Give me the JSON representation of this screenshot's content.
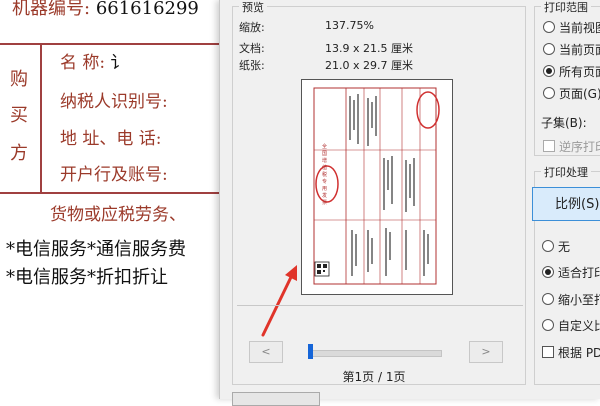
{
  "invoice": {
    "machine_label": "机器编号:",
    "machine_number": "661616299",
    "buyer_chars": [
      "购",
      "买",
      "方"
    ],
    "fields": [
      "名 称:",
      "纳税人识别号:",
      "地 址、电 话:",
      "开户行及账号:"
    ],
    "name_tail": "讠",
    "goods_header": "货物或应税劳务、",
    "items": [
      "*电信服务*通信服务费",
      "*电信服务*折扣折让"
    ]
  },
  "preview": {
    "group_title": "预览",
    "zoom_label": "缩放:",
    "zoom_value": "137.75%",
    "doc_label": "文档:",
    "doc_value": "13.9 x 21.5 厘米",
    "paper_label": "纸张:",
    "paper_value": "21.0 x 29.7 厘米",
    "mini_title": "全国增值税专用发票",
    "prev_button": "<",
    "next_button": ">",
    "page_indicator": "第1页 / 1页",
    "slider_position": 0.0
  },
  "print_range": {
    "title": "打印范围",
    "options": [
      "当前视图",
      "当前页面",
      "所有页面",
      "页面(G)"
    ],
    "selected": "所有页面",
    "subset_label": "子集(B):",
    "reverse_label": "逆序打印"
  },
  "print_handling": {
    "title": "打印处理",
    "scale_button": "比例(S)",
    "options": [
      "无",
      "适合打印",
      "缩小至打",
      "自定义比"
    ],
    "selected": "适合打印",
    "pdf_checkbox": "根据 PD"
  },
  "colors": {
    "accent": "#1565d8",
    "invoice_red": "#a04040",
    "stamp_red": "#d03030"
  }
}
